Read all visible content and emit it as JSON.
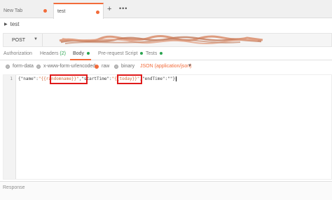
{
  "tabs": [
    {
      "label": "New Tab"
    },
    {
      "label": "test"
    }
  ],
  "tab_actions": {
    "add": "+",
    "more": "•••"
  },
  "request": {
    "name": "test",
    "method": "POST",
    "url_redacted": true
  },
  "request_tabs": {
    "authorization": "Authorization",
    "headers": "Headers",
    "headers_count": "(2)",
    "body": "Body",
    "pre_request": "Pre-request Script",
    "tests": "Tests"
  },
  "body_options": {
    "form_data": "form-data",
    "urlencoded": "x-www-form-urlencoded",
    "raw": "raw",
    "binary": "binary",
    "content_type": "JSON (application/json)",
    "selected": "raw"
  },
  "editor": {
    "line_number": "1",
    "code_prefix": "{\"name\":",
    "var1": "\"{{randomname}}\"",
    "code_mid": ",\"startTime\":",
    "var2": "\"{{today}}\"",
    "code_suffix": ",\"endTime\":\"\"}"
  },
  "response": {
    "label": "Response"
  },
  "colors": {
    "accent": "#f26b3a",
    "highlight_box": "#e01b1b",
    "green": "#2aa44f"
  }
}
